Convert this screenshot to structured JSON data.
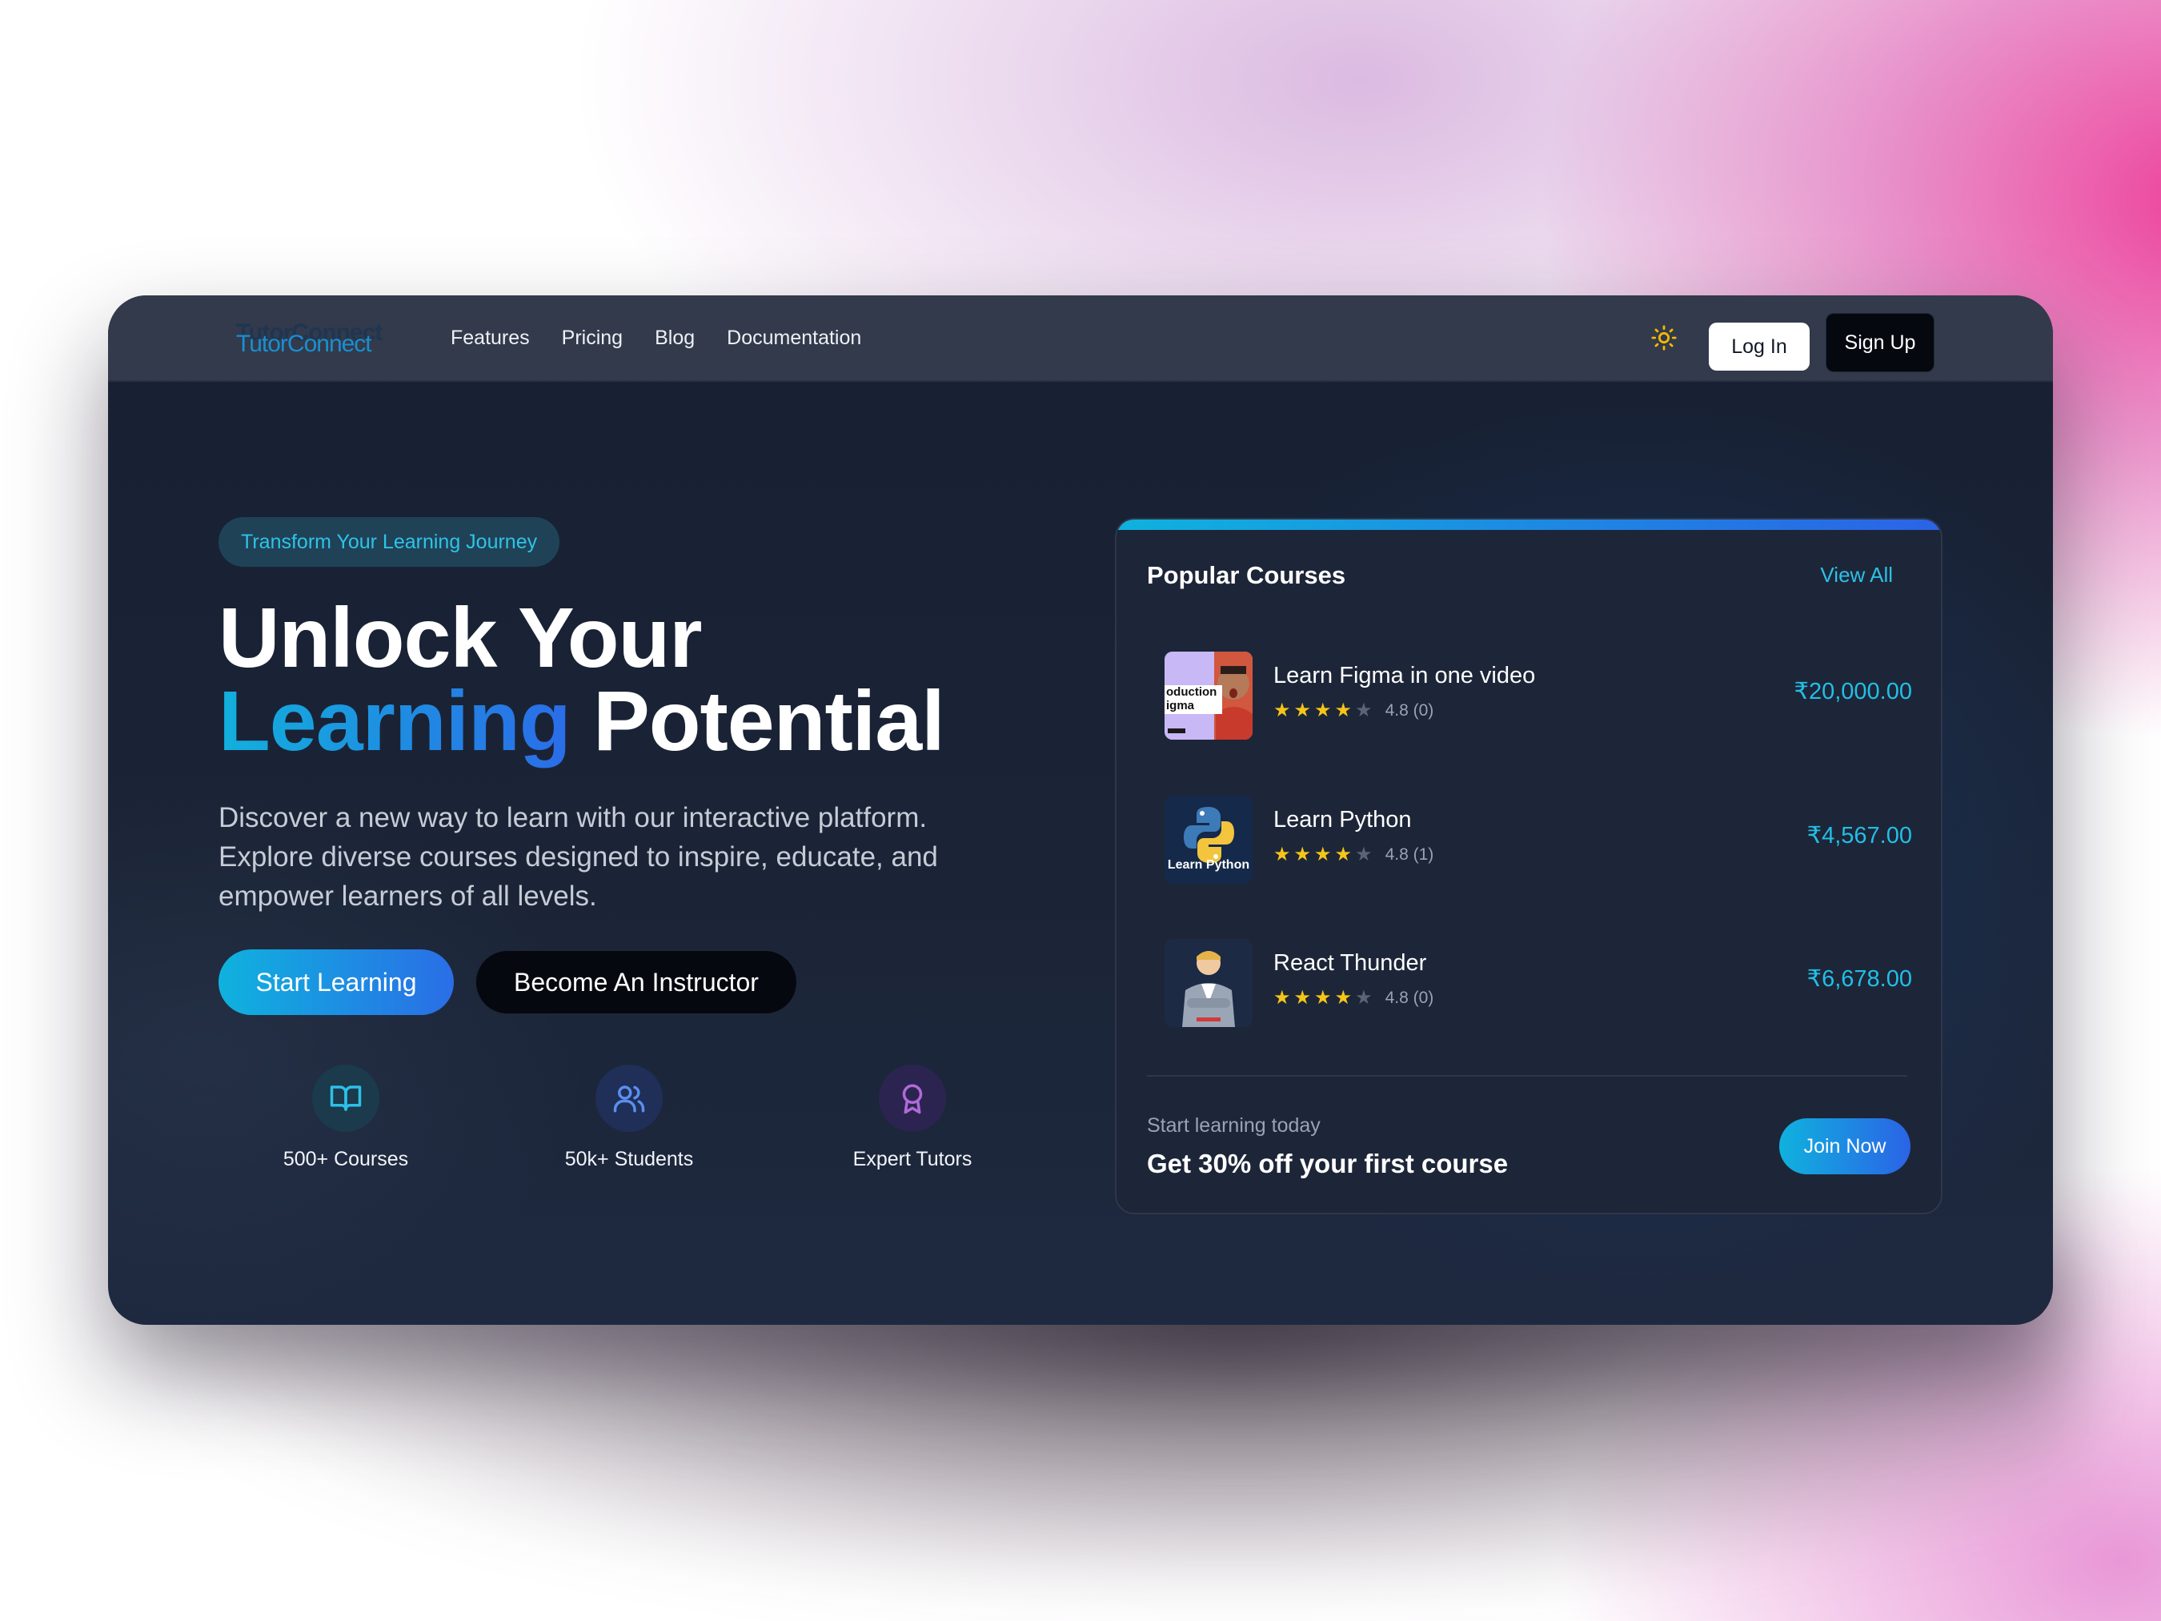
{
  "nav": {
    "logo_text": "TutorConnect",
    "links": [
      "Features",
      "Pricing",
      "Blog",
      "Documentation"
    ],
    "theme_icon": "sun-icon",
    "login_label": "Log In",
    "signup_label": "Sign Up"
  },
  "hero": {
    "badge": "Transform Your Learning Journey",
    "headline_line1": "Unlock Your",
    "headline_highlight": "Learning",
    "headline_rest": "Potential",
    "subtext": "Discover a new way to learn with our interactive platform. Explore diverse courses designed to inspire, educate, and empower learners of all levels.",
    "primary_cta": "Start Learning",
    "secondary_cta": "Become An Instructor",
    "stats": [
      {
        "label": "500+ Courses",
        "icon": "book-open-icon",
        "color": "#2cc0e8"
      },
      {
        "label": "50k+ Students",
        "icon": "users-icon",
        "color": "#5b8ef0"
      },
      {
        "label": "Expert Tutors",
        "icon": "award-icon",
        "color": "#b06ad8"
      }
    ]
  },
  "popular": {
    "title": "Popular Courses",
    "view_all": "View All",
    "courses": [
      {
        "name": "Learn Figma in one video",
        "rating": "4.8 (0)",
        "stars": 4,
        "price": "₹20,000.00",
        "thumb_text": "oduction igma"
      },
      {
        "name": "Learn Python",
        "rating": "4.8 (1)",
        "stars": 4,
        "price": "₹4,567.00",
        "thumb_text": "Learn Python"
      },
      {
        "name": "React Thunder",
        "rating": "4.8 (0)",
        "stars": 4,
        "price": "₹6,678.00",
        "thumb_text": ""
      }
    ],
    "promo_sub": "Start learning today",
    "promo_title": "Get 30% off your first course",
    "join_label": "Join Now"
  },
  "colors": {
    "accent_cyan": "#12b0dc",
    "accent_blue": "#2b63e6",
    "star_gold": "#f5c518",
    "background_dark": "#1b2436"
  }
}
